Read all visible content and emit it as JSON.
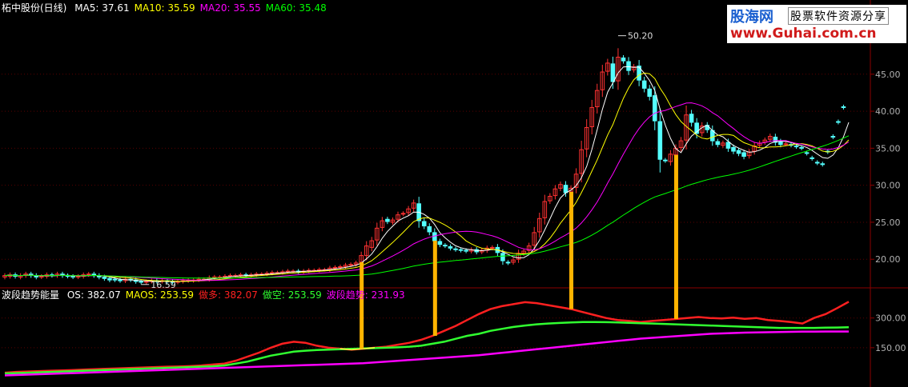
{
  "chart_data": [
    {
      "type": "candlestick",
      "title": "柘中股份(日线)",
      "ma_legend": [
        {
          "label": "MA5:",
          "value": "37.61",
          "color": "#ffffff"
        },
        {
          "label": "MA10:",
          "value": "35.59",
          "color": "#ffff00"
        },
        {
          "label": "MA20:",
          "value": "35.55",
          "color": "#ff00ff"
        },
        {
          "label": "MA60:",
          "value": "35.48",
          "color": "#00ff00"
        }
      ],
      "ylim": [
        17,
        52
      ],
      "y_ticks": [
        "20.00",
        "25.00",
        "30.00",
        "35.00",
        "40.00",
        "45.00"
      ],
      "annotations": [
        {
          "text": "50.20",
          "price": 50.2
        },
        {
          "text": "16.59",
          "price": 16.59
        }
      ],
      "series": {
        "close": [
          17.8,
          17.9,
          17.7,
          17.8,
          18.0,
          17.8,
          17.6,
          17.7,
          17.9,
          17.8,
          18.0,
          17.8,
          17.7,
          17.6,
          17.7,
          17.9,
          18.0,
          17.8,
          17.6,
          17.4,
          17.2,
          17.2,
          17.1,
          17.3,
          17.2,
          17.0,
          16.9,
          17.0,
          17.1,
          17.0,
          17.1,
          17.0,
          16.9,
          17.0,
          17.1,
          17.2,
          17.2,
          17.3,
          17.3,
          17.5,
          17.6,
          17.6,
          17.7,
          17.8,
          17.8,
          17.9,
          17.8,
          17.9,
          18.0,
          18.0,
          18.1,
          18.2,
          18.2,
          18.3,
          18.4,
          18.4,
          18.3,
          18.4,
          18.5,
          18.5,
          18.6,
          18.6,
          18.8,
          18.9,
          19.0,
          19.2,
          19.3,
          19.5,
          20.5,
          21.8,
          22.5,
          24.2,
          25.2,
          25.1,
          25.3,
          26.0,
          26.2,
          26.8,
          27.6,
          25.2,
          24.5,
          23.7,
          22.5,
          22.0,
          21.8,
          21.5,
          21.3,
          21.2,
          21.1,
          21.3,
          21.0,
          21.2,
          21.5,
          21.6,
          20.9,
          19.8,
          19.5,
          19.9,
          20.8,
          21.1,
          21.8,
          23.6,
          25.5,
          27.8,
          28.5,
          29.5,
          30.1,
          29.0,
          29.6,
          31.5,
          34.8,
          37.8,
          40.5,
          42.8,
          45.3,
          46.5,
          44.0,
          47.3,
          46.8,
          45.5,
          46.0,
          44.2,
          43.1,
          42.0,
          38.7,
          33.5,
          33.3,
          34.2,
          35.0,
          36.0,
          39.5,
          38.5,
          37.0,
          38.0,
          37.5,
          36.0,
          35.5,
          35.7,
          35.0,
          34.6,
          34.3,
          33.9,
          34.5,
          35.3,
          35.7,
          36.1,
          36.6,
          35.8,
          35.5,
          35.6,
          35.4,
          35.2,
          35.0,
          34.3,
          33.6,
          33.0,
          32.8,
          34.5,
          36.5,
          38.5,
          40.5,
          42.5
        ],
        "open": [
          17.6,
          17.7,
          17.9,
          17.6,
          17.8,
          18.0,
          17.8,
          17.6,
          17.7,
          17.9,
          17.8,
          18.0,
          17.8,
          17.7,
          17.6,
          17.7,
          17.9,
          18.0,
          17.8,
          17.6,
          17.4,
          17.3,
          17.2,
          17.1,
          17.3,
          17.2,
          17.0,
          16.9,
          17.0,
          17.1,
          17.0,
          17.1,
          17.0,
          16.9,
          17.0,
          17.1,
          17.1,
          17.2,
          17.3,
          17.3,
          17.5,
          17.6,
          17.6,
          17.7,
          17.8,
          17.8,
          17.9,
          17.8,
          17.9,
          18.0,
          18.0,
          18.1,
          18.2,
          18.2,
          18.3,
          18.4,
          18.4,
          18.3,
          18.4,
          18.5,
          18.5,
          18.6,
          18.6,
          18.8,
          18.9,
          19.0,
          19.2,
          19.3,
          19.6,
          20.5,
          21.6,
          22.6,
          24.3,
          25.4,
          25.0,
          25.4,
          26.1,
          26.3,
          26.9,
          27.5,
          25.1,
          24.4,
          23.6,
          22.4,
          21.9,
          21.7,
          21.4,
          21.3,
          21.2,
          21.1,
          21.3,
          21.0,
          21.2,
          21.5,
          21.6,
          20.8,
          19.6,
          19.6,
          20.0,
          20.8,
          21.2,
          21.9,
          23.7,
          25.6,
          27.9,
          28.6,
          29.6,
          30.0,
          29.1,
          29.7,
          31.6,
          34.9,
          37.9,
          40.6,
          42.9,
          45.4,
          46.4,
          44.1,
          47.2,
          46.7,
          45.6,
          46.1,
          44.1,
          43.0,
          42.1,
          38.6,
          33.4,
          33.2,
          34.1,
          35.1,
          36.1,
          39.6,
          38.4,
          37.1,
          38.1,
          37.4,
          35.9,
          35.4,
          35.8,
          35.1,
          34.7,
          34.4,
          34.0,
          34.6,
          35.4,
          35.8,
          36.2,
          36.5,
          35.9,
          35.6,
          35.5,
          35.3,
          35.1,
          34.4,
          33.7,
          33.1,
          32.9,
          34.6,
          36.6,
          38.6,
          40.6
        ]
      }
    },
    {
      "type": "line",
      "title": "波段趋势能量",
      "legend": [
        {
          "label": "OS:",
          "value": "382.07",
          "color": "#ffffff"
        },
        {
          "label": "MAOS:",
          "value": "253.59",
          "color": "#ffff00"
        },
        {
          "label": "做多:",
          "value": "382.07",
          "color": "#ff2020"
        },
        {
          "label": "做空:",
          "value": "253.59",
          "color": "#30ff30"
        },
        {
          "label": "波段趋势:",
          "value": "231.93",
          "color": "#ff00ff"
        }
      ],
      "ylim": [
        0,
        420
      ],
      "y_ticks": [
        "150.00",
        "300.00"
      ],
      "series": [
        {
          "name": "OS",
          "values": [
            24,
            28,
            30,
            32,
            34,
            35,
            37,
            40,
            42,
            44,
            46,
            48,
            50,
            52,
            54,
            55,
            57,
            60,
            65,
            70,
            85,
            105,
            125,
            150,
            170,
            180,
            175,
            160,
            150,
            145,
            140,
            145,
            150,
            155,
            165,
            175,
            190,
            210,
            235,
            260,
            290,
            320,
            345,
            360,
            370,
            380,
            375,
            365,
            355,
            345,
            330,
            315,
            300,
            290,
            285,
            280,
            285,
            290,
            295,
            300,
            305,
            300,
            298,
            302,
            296,
            300,
            290,
            285,
            280,
            272,
            300,
            320,
            350,
            382
          ]
        },
        {
          "name": "MAOS",
          "values": [
            20,
            22,
            24,
            26,
            28,
            30,
            32,
            34,
            36,
            38,
            40,
            42,
            44,
            46,
            48,
            50,
            52,
            54,
            56,
            60,
            70,
            80,
            95,
            110,
            120,
            130,
            135,
            138,
            140,
            142,
            144,
            146,
            148,
            150,
            152,
            155,
            160,
            170,
            180,
            195,
            210,
            220,
            235,
            245,
            255,
            262,
            268,
            272,
            275,
            278,
            280,
            280,
            279,
            278,
            276,
            274,
            272,
            270,
            268,
            266,
            264,
            262,
            260,
            258,
            256,
            254,
            252,
            250,
            250,
            250,
            250,
            251,
            252,
            253.59
          ]
        },
        {
          "name": "波段趋势",
          "values": [
            10,
            12,
            14,
            16,
            18,
            20,
            22,
            24,
            26,
            28,
            30,
            32,
            34,
            36,
            38,
            40,
            42,
            44,
            46,
            48,
            50,
            52,
            54,
            56,
            58,
            60,
            62,
            64,
            66,
            68,
            70,
            72,
            76,
            80,
            84,
            88,
            92,
            96,
            100,
            104,
            108,
            112,
            118,
            124,
            130,
            136,
            142,
            148,
            154,
            160,
            166,
            172,
            178,
            184,
            190,
            196,
            200,
            204,
            208,
            212,
            216,
            220,
            222,
            224,
            226,
            227,
            228,
            229,
            230,
            231,
            231.5,
            231.8,
            231.9,
            231.93
          ]
        }
      ]
    }
  ],
  "watermark": {
    "title": "股海网",
    "tagline": "股票软件资源分享",
    "url": "www.Guhai.com.cn"
  }
}
